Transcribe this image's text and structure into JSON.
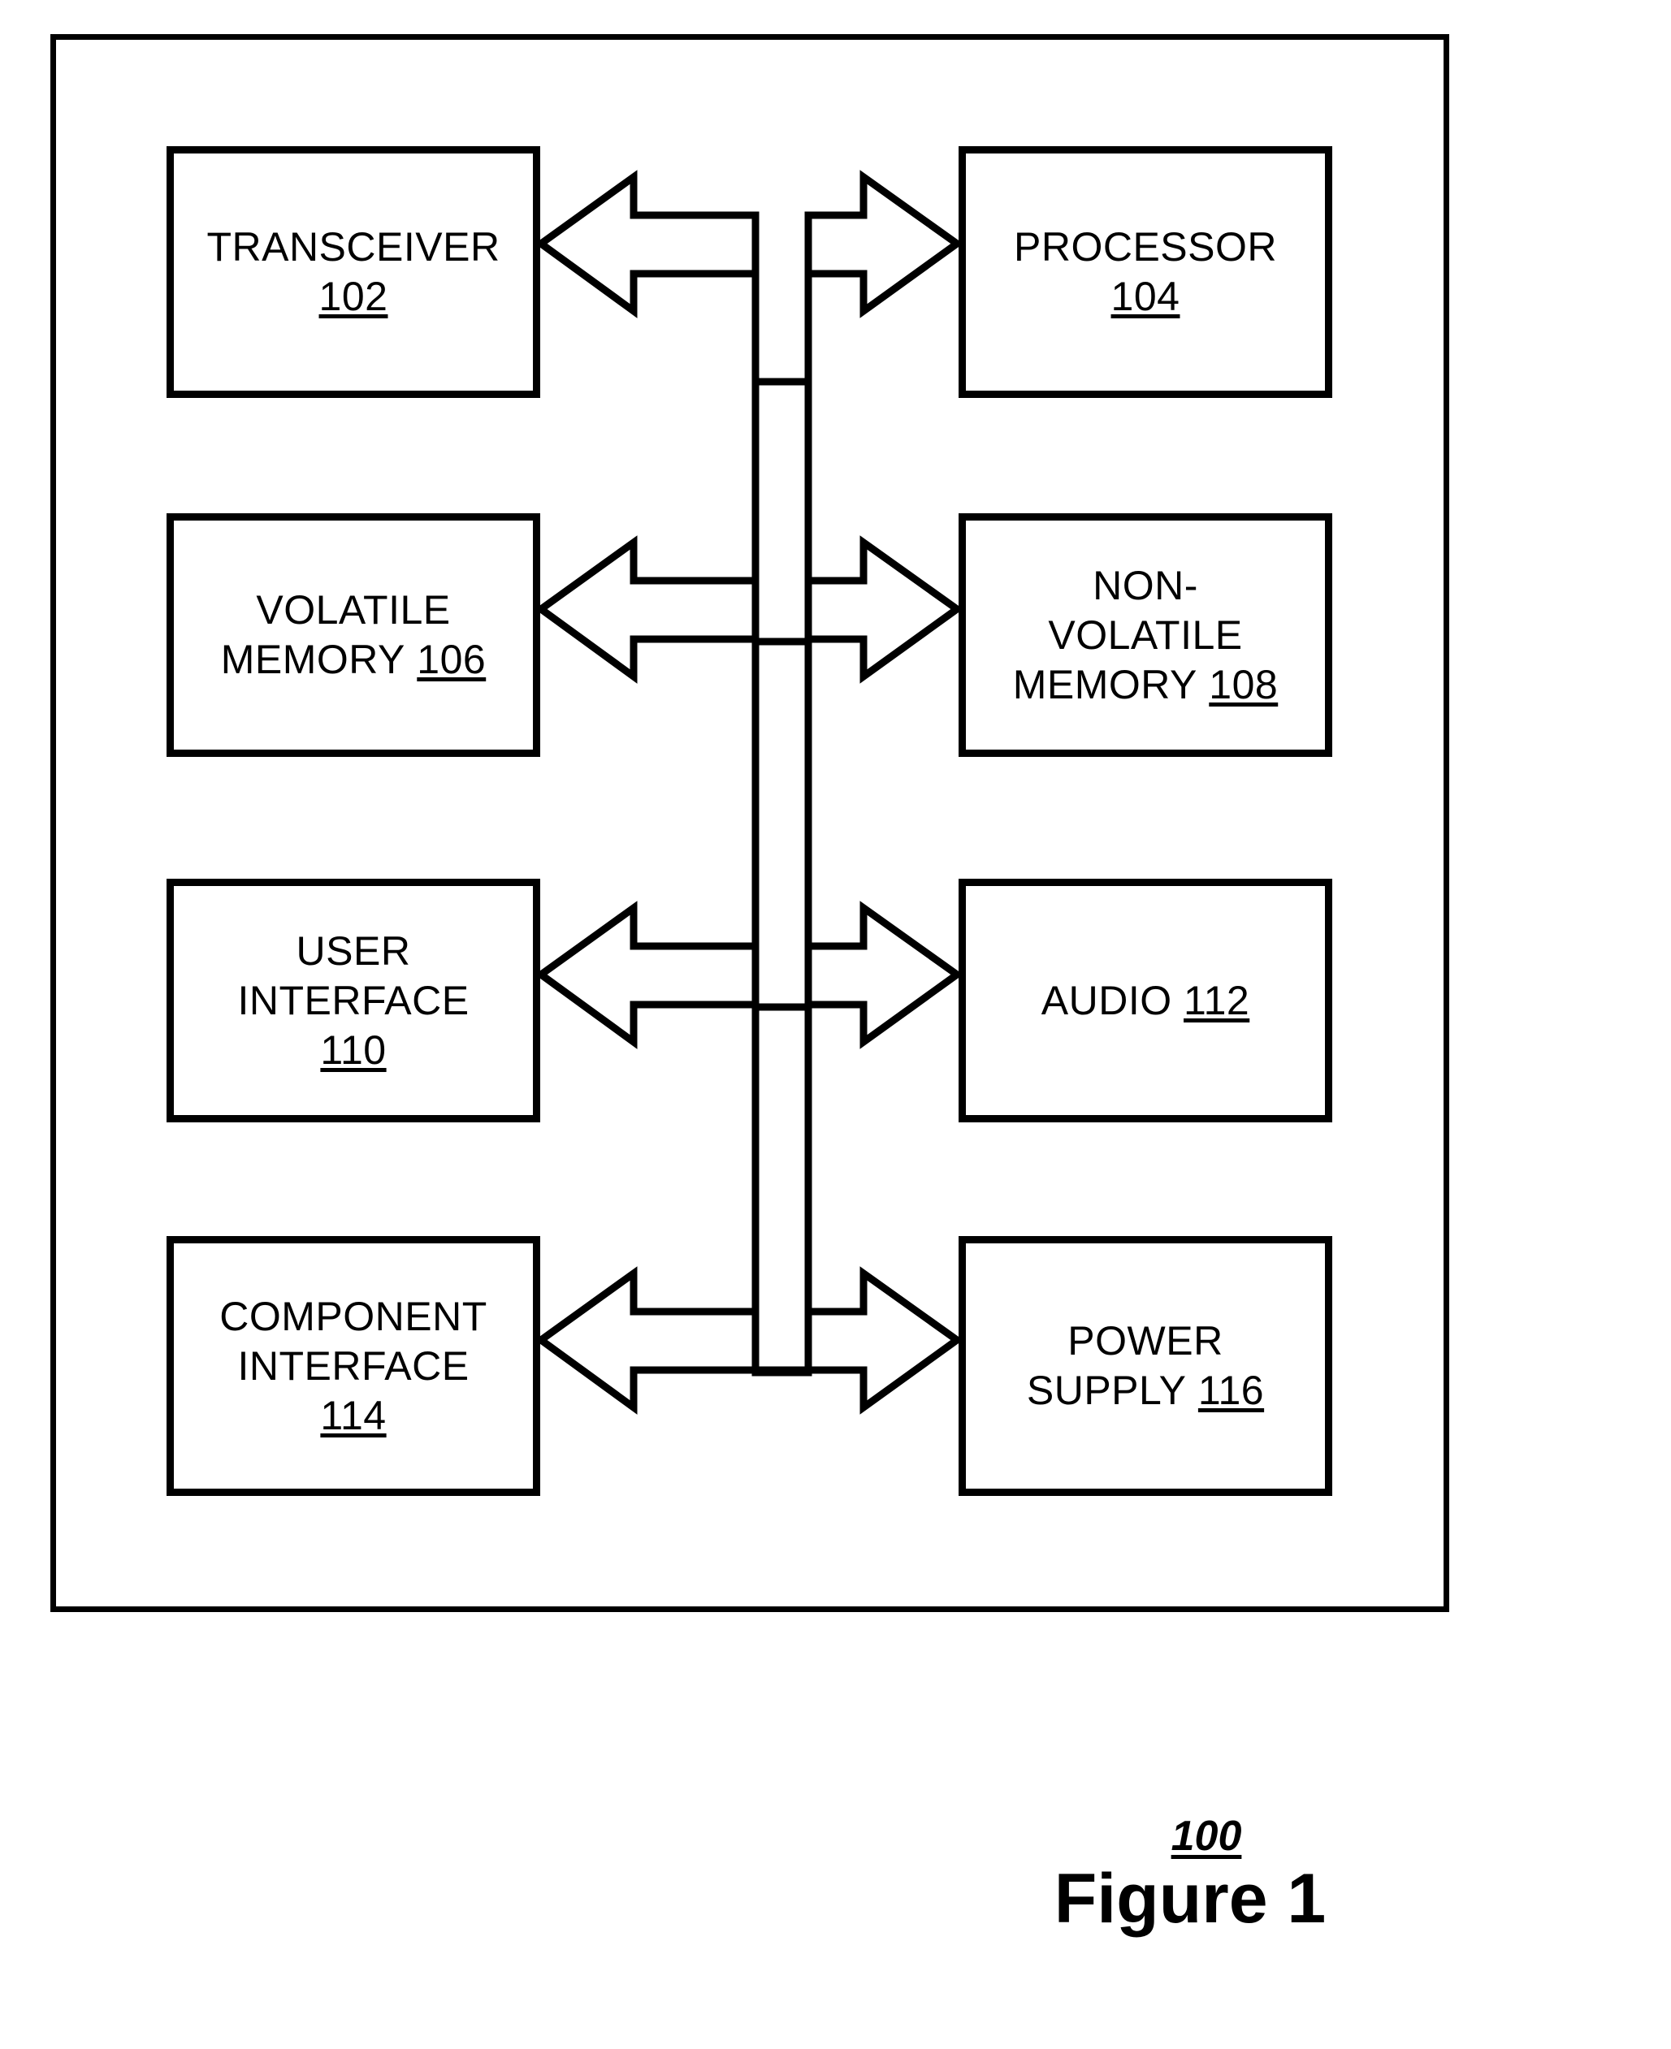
{
  "figure": {
    "number_ref": "100",
    "label": "Figure 1"
  },
  "diagram_data": {
    "type": "block-diagram",
    "title": "Figure 1",
    "enclosure_ref": "100",
    "layout": {
      "columns": 2,
      "rows": 4
    },
    "blocks": [
      {
        "id": "transceiver",
        "row": 1,
        "column": "left",
        "line1": "TRANSCEIVER",
        "line2": "",
        "line3": "",
        "ref": "102",
        "ref_position": "own-line"
      },
      {
        "id": "processor",
        "row": 1,
        "column": "right",
        "line1": "PROCESSOR",
        "line2": "",
        "line3": "",
        "ref": "104",
        "ref_position": "own-line"
      },
      {
        "id": "volatile-memory",
        "row": 2,
        "column": "left",
        "line1": "VOLATILE",
        "line2": "MEMORY",
        "line3": "",
        "ref": "106",
        "ref_position": "inline-line2"
      },
      {
        "id": "non-volatile-memory",
        "row": 2,
        "column": "right",
        "line1": "NON-",
        "line2": "VOLATILE",
        "line3": "MEMORY",
        "ref": "108",
        "ref_position": "inline-line3"
      },
      {
        "id": "user-interface",
        "row": 3,
        "column": "left",
        "line1": "USER",
        "line2": "INTERFACE",
        "line3": "",
        "ref": "110",
        "ref_position": "own-line"
      },
      {
        "id": "audio",
        "row": 3,
        "column": "right",
        "line1": "AUDIO",
        "line2": "",
        "line3": "",
        "ref": "112",
        "ref_position": "inline-line1"
      },
      {
        "id": "component-interface",
        "row": 4,
        "column": "left",
        "line1": "COMPONENT",
        "line2": "INTERFACE",
        "line3": "",
        "ref": "114",
        "ref_position": "own-line"
      },
      {
        "id": "power-supply",
        "row": 4,
        "column": "right",
        "line1": "POWER",
        "line2": "SUPPLY",
        "line3": "",
        "ref": "116",
        "ref_position": "inline-line2"
      }
    ],
    "connections": [
      {
        "from": "bus",
        "to": "transceiver",
        "style": "block-arrow",
        "direction": "left"
      },
      {
        "from": "bus",
        "to": "processor",
        "style": "block-arrow",
        "direction": "right"
      },
      {
        "from": "bus",
        "to": "volatile-memory",
        "style": "block-arrow",
        "direction": "left"
      },
      {
        "from": "bus",
        "to": "non-volatile-memory",
        "style": "block-arrow",
        "direction": "right"
      },
      {
        "from": "bus",
        "to": "user-interface",
        "style": "block-arrow",
        "direction": "left"
      },
      {
        "from": "bus",
        "to": "audio",
        "style": "block-arrow",
        "direction": "right"
      },
      {
        "from": "bus",
        "to": "component-interface",
        "style": "block-arrow",
        "direction": "left"
      },
      {
        "from": "bus",
        "to": "power-supply",
        "style": "block-arrow",
        "direction": "right"
      }
    ],
    "colors": {
      "stroke": "#000000",
      "background": "#ffffff"
    }
  },
  "blocks": {
    "transceiver": {
      "line1": "TRANSCEIVER",
      "ref": "102"
    },
    "processor": {
      "line1": "PROCESSOR",
      "ref": "104"
    },
    "volatile_memory": {
      "line1": "VOLATILE",
      "line2": "MEMORY",
      "ref": "106"
    },
    "non_volatile_memory": {
      "line1": "NON-",
      "line2": "VOLATILE",
      "line3": "MEMORY",
      "ref": "108"
    },
    "user_interface": {
      "line1": "USER",
      "line2": "INTERFACE",
      "ref": "110"
    },
    "audio": {
      "line1": "AUDIO",
      "ref": "112"
    },
    "component_interface": {
      "line1": "COMPONENT",
      "line2": "INTERFACE",
      "ref": "114"
    },
    "power_supply": {
      "line1": "POWER",
      "line2": "SUPPLY",
      "ref": "116"
    }
  }
}
